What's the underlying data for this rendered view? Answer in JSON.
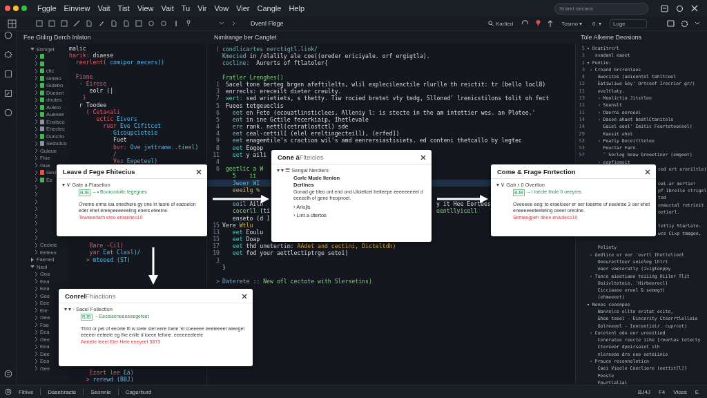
{
  "menu": [
    "Fggle",
    "Einview",
    "Vait",
    "Tist",
    "View",
    "Vait",
    "Tu",
    "Vir",
    "Vow",
    "Vier",
    "Cangle",
    "Help"
  ],
  "search": {
    "placeholder": "Sraret secans"
  },
  "toolbar": {
    "title": "Dvenl Fkige",
    "find": "Kartied",
    "selects": [
      "Tosmo ▾",
      "0. ▾"
    ],
    "login": "Loge"
  },
  "panels": {
    "left": "Fee Gtilirg Derch Inlaton",
    "center": "Nimlrange ber Cangtet",
    "right": "Tole Alkeine Deosions"
  },
  "tree": [
    {
      "label": "Ebmget",
      "expanded": true,
      "children": [
        {
          "expanded": false,
          "color": "#3fb950"
        },
        {
          "expanded": false,
          "color": "#3fb950"
        },
        {
          "label": "ctic",
          "expanded": false,
          "color": "#3fb950"
        },
        {
          "label": "Gnieio",
          "expanded": false,
          "color": "#3fb950"
        },
        {
          "label": "Gulebo",
          "expanded": false,
          "color": "#3fb950"
        },
        {
          "label": "Duesen",
          "expanded": false,
          "color": "#3fb950"
        },
        {
          "label": "dnotes",
          "expanded": false,
          "color": "#3fb950"
        },
        {
          "label": "Auleio",
          "expanded": false,
          "color": "#3fb950"
        },
        {
          "label": "Auenee",
          "expanded": false,
          "color": "#3fb950"
        },
        {
          "label": "Enolsco",
          "expanded": false,
          "color": "#8b949e"
        },
        {
          "label": "Eneciec",
          "expanded": false,
          "color": "#8b949e"
        },
        {
          "label": "Duncrio",
          "expanded": false,
          "color": "#3fb950"
        },
        {
          "label": "Sedudco",
          "expanded": false,
          "color": "#8b949e"
        },
        {
          "label": "Guieue",
          "expanded": false
        },
        {
          "label": "Fiue",
          "expanded": false
        },
        {
          "label": "Gua",
          "expanded": false
        },
        {
          "label": "Ged",
          "expanded": false,
          "color": "#e5534b"
        },
        {
          "label": "Ee",
          "expanded": false,
          "color": "#3fb950"
        },
        {
          "expanded": false
        },
        {
          "expanded": false
        },
        {
          "expanded": false
        },
        {
          "expanded": false
        },
        {
          "expanded": false
        },
        {
          "expanded": false
        },
        {
          "expanded": false
        },
        {
          "expanded": false
        },
        {
          "label": "Cecieie",
          "expanded": false
        },
        {
          "label": "Eeteeo",
          "expanded": false
        }
      ]
    },
    {
      "label": "Faened",
      "expanded": false
    },
    {
      "label": "Neol",
      "expanded": true,
      "children": [
        {
          "label": "Gea",
          "expanded": false
        },
        {
          "label": "Eea",
          "expanded": false
        },
        {
          "label": "Eea",
          "expanded": false
        },
        {
          "label": "Gee",
          "expanded": false
        },
        {
          "label": "Eee",
          "expanded": false
        },
        {
          "label": "Eie",
          "expanded": false
        },
        {
          "label": "Gea",
          "expanded": false
        },
        {
          "label": "Fae",
          "expanded": false
        },
        {
          "label": "Eea",
          "expanded": false
        },
        {
          "label": "Gee",
          "expanded": false
        },
        {
          "label": "Eea",
          "expanded": false
        },
        {
          "label": "Dee",
          "expanded": false
        },
        {
          "label": "Eeo",
          "expanded": false
        },
        {
          "label": "Gee",
          "expanded": false
        }
      ]
    }
  ],
  "left_code": [
    {
      "kind": "code",
      "parts": [
        {
          "text": "malic",
          "kind": "tx"
        }
      ]
    },
    {
      "kind": "code",
      "parts": [
        {
          "text": "harik: ",
          "kind": "kw"
        },
        {
          "text": "diaese",
          "kind": "tx"
        }
      ]
    },
    {
      "kind": "code",
      "parts": [
        {
          "text": "  reerlent( ",
          "kind": "kw"
        },
        {
          "text": "comipor mecers))",
          "kind": "id"
        }
      ]
    },
    {
      "kind": "blank"
    },
    {
      "kind": "code",
      "parts": [
        {
          "text": "  Fione",
          "kind": "kw"
        }
      ]
    },
    {
      "kind": "code",
      "parts": [
        {
          "text": "   - Eirese",
          "kind": "kw"
        }
      ]
    },
    {
      "kind": "code",
      "parts": [
        {
          "text": "      eolr (|",
          "kind": "tx"
        }
      ]
    },
    {
      "kind": "code",
      "parts": [
        {
          "text": "    }",
          "kind": "kw"
        }
      ]
    },
    {
      "kind": "code",
      "parts": [
        {
          "text": "   r Toodee",
          "kind": "tx"
        }
      ]
    },
    {
      "kind": "code",
      "parts": [
        {
          "text": "     ( Ceta<ali",
          "kind": "kw"
        }
      ]
    },
    {
      "kind": "code",
      "parts": [
        {
          "text": "        ectic ",
          "kind": "kw"
        },
        {
          "text": "Eivers",
          "kind": "id"
        }
      ]
    },
    {
      "kind": "code",
      "parts": [
        {
          "text": "          ruor ",
          "kind": "kw"
        },
        {
          "text": "Eve Cifitcet",
          "kind": "id"
        }
      ]
    },
    {
      "kind": "code",
      "parts": [
        {
          "text": "             Gicoupcieteie",
          "kind": "id"
        }
      ]
    },
    {
      "kind": "code",
      "parts": [
        {
          "text": "             Fuet",
          "kind": "tx"
        }
      ]
    },
    {
      "kind": "code",
      "parts": [
        {
          "text": "             bvr: ",
          "kind": "kw"
        },
        {
          "text": "Ove jettrame..tieel)",
          "kind": "id"
        }
      ]
    },
    {
      "kind": "code",
      "parts": [
        {
          "text": "             /",
          "kind": "kw"
        }
      ]
    },
    {
      "kind": "code",
      "parts": [
        {
          "text": "             Vez ",
          "kind": "kw"
        },
        {
          "text": "Eepeteel)",
          "kind": "id"
        }
      ]
    },
    {
      "kind": "blank"
    },
    {
      "kind": "blank"
    },
    {
      "kind": "blank"
    },
    {
      "kind": "blank"
    },
    {
      "kind": "blank"
    },
    {
      "kind": "blank"
    },
    {
      "kind": "blank"
    },
    {
      "kind": "blank"
    },
    {
      "kind": "blank"
    },
    {
      "kind": "blank"
    },
    {
      "kind": "blank"
    },
    {
      "kind": "code",
      "parts": [
        {
          "text": "      Bare -Cil)",
          "kind": "kw"
        }
      ]
    },
    {
      "kind": "code",
      "parts": [
        {
          "text": "      yar ",
          "kind": "kw"
        },
        {
          "text": "Eat Clasl)/",
          "kind": "id"
        }
      ]
    },
    {
      "kind": "code",
      "parts": [
        {
          "text": "     > ",
          "kind": "kw"
        },
        {
          "text": "mteeed (ST)",
          "kind": "id"
        }
      ]
    },
    {
      "kind": "blank"
    },
    {
      "kind": "blank"
    },
    {
      "kind": "blank"
    },
    {
      "kind": "blank"
    },
    {
      "kind": "blank"
    },
    {
      "kind": "blank"
    },
    {
      "kind": "blank"
    },
    {
      "kind": "blank"
    },
    {
      "kind": "blank"
    },
    {
      "kind": "blank"
    },
    {
      "kind": "blank"
    },
    {
      "kind": "blank"
    },
    {
      "kind": "blank"
    },
    {
      "kind": "blank"
    },
    {
      "kind": "blank"
    },
    {
      "kind": "code",
      "parts": [
        {
          "text": "      Ezart lee ",
          "kind": "kw"
        },
        {
          "text": "Eä)",
          "kind": "id"
        }
      ]
    },
    {
      "kind": "code",
      "parts": [
        {
          "text": "     > ",
          "kind": "kw"
        },
        {
          "text": "rerewd (B8J)",
          "kind": "id"
        }
      ]
    }
  ],
  "center_code": [
    {
      "kind": "code",
      "num": "(",
      "parts": [
        {
          "text": "condlicartes nerctigtl.link/",
          "kind": "cm"
        }
      ]
    },
    {
      "kind": "code",
      "parts": [
        {
          "text": "Kmecied ",
          "kind": "cm"
        },
        {
          "text": "in /olalily ale coe((oreder ericiyale. orf ergigtla).",
          "kind": "tx"
        }
      ]
    },
    {
      "kind": "code",
      "parts": [
        {
          "text": "cocline: ",
          "kind": "cm"
        },
        {
          "text": " Aurerts of ftlatoler{",
          "kind": "tx"
        }
      ]
    },
    {
      "kind": "blank"
    },
    {
      "kind": "code",
      "parts": [
        {
          "text": "Fratler Lrenghes()",
          "kind": "gr"
        }
      ]
    },
    {
      "kind": "code",
      "num": "1",
      "parts": [
        {
          "text": " Sacel tone berteg brgen afeftilelts, wlil explecilenctile rlurlle th reictit: tr (bello locl8)",
          "kind": "tx"
        }
      ]
    },
    {
      "kind": "code",
      "num": "3",
      "parts": [
        {
          "text": " enrrecls: ereceilt dieter creulty.",
          "kind": "tx"
        }
      ]
    },
    {
      "kind": "code",
      "num": "7",
      "parts": [
        {
          "text": " wert: ",
          "kind": "cm"
        },
        {
          "text": "sed wrietiets, s thetty. Tiw rocied bretet vty tedg, Slloned' lrenicstilons tolit oh fect",
          "kind": "tx"
        }
      ]
    },
    {
      "kind": "code",
      "num": "5",
      "parts": [
        {
          "text": " Fuees tetgeueclis",
          "kind": "tx"
        }
      ]
    },
    {
      "kind": "code",
      "num": "6",
      "parts": [
        {
          "text": "   eet ",
          "kind": "cm"
        },
        {
          "text": "en Fete (ecouatlinsticlees, Alleniy l: is stecte in the am intettier wes. an Plotee.'",
          "kind": "tx"
        }
      ]
    },
    {
      "kind": "code",
      "num": "5",
      "parts": [
        {
          "text": "   ent ",
          "kind": "cm"
        },
        {
          "text": "in ine Gctile fecerkiaip, Ihetlevale",
          "kind": "tx"
        }
      ]
    },
    {
      "kind": "code",
      "num": "4",
      "parts": [
        {
          "text": "   ere ",
          "kind": "cm"
        },
        {
          "text": "rank. nettl(cetratlostctl) sde",
          "kind": "tx"
        }
      ]
    },
    {
      "kind": "code",
      "num": "4",
      "parts": [
        {
          "text": "   eet ",
          "kind": "cm"
        },
        {
          "text": "ceal-cettil[ (elel ereltingecteill), (erfed])",
          "kind": "tx"
        }
      ]
    },
    {
      "kind": "code",
      "num": "9",
      "parts": [
        {
          "text": "   eet ",
          "kind": "cm"
        },
        {
          "text": "enagemtile's craction wil's amd eenrersiastisiets. ed conteni thetcallo by legtec",
          "kind": "tx"
        }
      ]
    },
    {
      "kind": "code",
      "num": "0",
      "parts": [
        {
          "text": "   eet ",
          "kind": "cm"
        },
        {
          "text": "Eogop",
          "kind": "tx"
        }
      ]
    },
    {
      "kind": "code",
      "num": "11",
      "parts": [
        {
          "text": "   eet ",
          "kind": "cm"
        },
        {
          "text": "y aili",
          "kind": "tx"
        }
      ]
    },
    {
      "kind": "blank",
      "num": "4"
    },
    {
      "kind": "code",
      "num": "6",
      "parts": [
        {
          "text": " geetlic a W",
          "kind": "gr"
        }
      ]
    },
    {
      "kind": "code",
      "parts": [
        {
          "text": "   5    ii",
          "kind": "gr"
        }
      ]
    },
    {
      "kind": "code",
      "highlighted": true,
      "parts": [
        {
          "text": "   Jwoer WI",
          "kind": "id"
        }
      ]
    },
    {
      "kind": "code",
      "parts": [
        {
          "text": "   eeeilg %",
          "kind": "str"
        }
      ]
    },
    {
      "kind": "blank"
    },
    {
      "kind": "code",
      "parts": [
        {
          "text": "   eoil ",
          "kind": "cm"
        },
        {
          "text": "Ailh",
          "kind": "tx"
        }
      ],
      "tail": [
        {
          "text": "y it Hee Eortees",
          "kind": "tx"
        }
      ]
    },
    {
      "kind": "code",
      "parts": [
        {
          "text": "   cocerll ",
          "kind": "gr"
        },
        {
          "text": "(ti",
          "kind": "tx"
        }
      ],
      "tail": [
        {
          "text": "eentllyicell",
          "kind": "gr"
        }
      ]
    },
    {
      "kind": "code",
      "parts": [
        {
          "text": "   enseto ",
          "kind": "tx"
        },
        {
          "text": "(d I",
          "kind": "tx"
        }
      ]
    },
    {
      "kind": "code",
      "num": "15",
      "parts": [
        {
          "text": "Vere ",
          "kind": "tx"
        },
        {
          "text": "Wtlu",
          "kind": "str"
        }
      ]
    },
    {
      "kind": "code",
      "num": "13",
      "parts": [
        {
          "text": "   eet ",
          "kind": "cm"
        },
        {
          "text": "Eoulu",
          "kind": "tx"
        }
      ]
    },
    {
      "kind": "code",
      "num": "15",
      "parts": [
        {
          "text": "   eet ",
          "kind": "cm"
        },
        {
          "text": "Doap",
          "kind": "tx"
        }
      ]
    },
    {
      "kind": "code",
      "num": "17",
      "parts": [
        {
          "text": "   eet ",
          "kind": "cm"
        },
        {
          "text": "thd unetertim: ",
          "kind": "tx"
        },
        {
          "text": "AAdet and cectini, Dicteltdh)",
          "kind": "str"
        }
      ]
    },
    {
      "kind": "code",
      "num": "19",
      "parts": [
        {
          "text": "   eet ",
          "kind": "cm"
        },
        {
          "text": "fod your aettlectiptrge setoi)",
          "kind": "tx"
        }
      ]
    },
    {
      "kind": "blank",
      "num": "3"
    },
    {
      "kind": "code",
      "parts": [
        {
          "text": "}",
          "kind": "tx"
        }
      ]
    },
    {
      "kind": "blank"
    },
    {
      "kind": "code",
      "num": ">",
      "parts": [
        {
          "text": "Daterete ",
          "kind": "id"
        },
        {
          "text": ":: New ofl cectote with Slersetins)",
          "kind": "gr"
        }
      ]
    }
  ],
  "outline": [
    {
      "num": "5",
      "text": "▾ Ocatitrcrl"
    },
    {
      "num": "1",
      "text": "   evadanl eaeet"
    },
    {
      "num": "1",
      "text": "▾ Fonlie:"
    },
    {
      "num": "3",
      "text": " › Crnand Grcrenlaes"
    },
    {
      "num": "4",
      "text": "    Awecites (aeieentel tahltcoel"
    },
    {
      "num": "12",
      "text": "    Eatiwliwe Gey' Ortceef Irecrier gr/)"
    },
    {
      "num": "11",
      "text": "    eveltlaty."
    },
    {
      "num": "13",
      "text": "    › Moolictio Jitstlee"
    },
    {
      "num": "11",
      "text": "    › Seanslt"
    },
    {
      "num": "11",
      "text": "    › Oaerni oereeel"
    },
    {
      "num": "14",
      "text": "    › Dasee ahaet beatlCtanitels"
    },
    {
      "num": "14",
      "text": "      Gaiel eoel' Emitic Feorteteoceel)"
    },
    {
      "num": "29",
      "text": "      Kaesit ehet"
    },
    {
      "num": "53",
      "text": "    › Peatly Deceittlelee"
    },
    {
      "num": "53",
      "text": "      Pouctar Farn."
    },
    {
      "num": "57",
      "text": "      ˇ Secleg beaw Greoetiner (emgeot)"
    },
    {
      "text": "    › eopfiemeit"
    },
    {
      "tail": "ced ert ereriltle)"
    },
    {
      "kind": "blank"
    },
    {
      "tail": "eal-ar mertie!"
    },
    {
      "tail": "pf Ibrelle ctrigel"
    },
    {
      "tail": "ted"
    },
    {
      "tail": "enauctal retrieit"
    },
    {
      "tail": "oetiorl."
    },
    {
      "kind": "blank"
    },
    {
      "tail": "tetliy Slarlote-"
    },
    {
      "tail": "wcs Cixp tmagee,"
    },
    {
      "kind": "blank"
    },
    {
      "text": "    Peliety"
    },
    {
      "text": " › Gedlice er eer 'evrtl Ihetlelieel"
    },
    {
      "text": "    Oeeurectteer seieleg lhtrt"
    },
    {
      "text": "    eoer vaeceratly (ivigtonppy"
    },
    {
      "text": " › Tonce aieetiaee teiiing Oiiler Tlit"
    },
    {
      "text": "    Ooiivlteteie. 'Hirbeerecl)"
    },
    {
      "text": "    Cicciasee ereel & semegt)"
    },
    {
      "text": "    (ehmeeeet)"
    },
    {
      "text": "▾ Nenes ceeenpee"
    },
    {
      "text": "    Nonrelce ellte eritat ecite,"
    },
    {
      "text": "    Ghoe teeel - Eiecerity Cteerrtlelleie"
    },
    {
      "text": "    Golreeeel - Ieeceetieir. cuprcet)"
    },
    {
      "text": " › Cocetenl ede eer ureeitiod"
    },
    {
      "text": "    Ceneratee reecte iihe [reonlas tetecty"
    },
    {
      "text": "    Ctereeer dpeirsoiet ilh"
    },
    {
      "text": "    nlereeoe dre eee eeteiinie"
    },
    {
      "text": " › Prouce recenneleticn"
    },
    {
      "text": "    Caei Vioele Coecliore (eettit[l]]"
    },
    {
      "text": "    Peeste"
    },
    {
      "text": "    Fourtlalial"
    }
  ],
  "popups": [
    {
      "title": "Leave d Fege Fhitecius",
      "rows": [
        {
          "kind": "tree",
          "text": "▾  ∨  Gate a Ftasetion"
        },
        {
          "kind": "tag",
          "badge": "BJB",
          "text": "– • Boorcoriotic tegegnes"
        },
        {
          "kind": "para",
          "text": "Oveme erma ioa onedhere gy one ln taore of eacoeion eder ehet ereepeeeeeeling eners eteeine."
        },
        {
          "kind": "error",
          "text": "Teweeeriarh eteo emaeheo10"
        }
      ]
    },
    {
      "title": "Cone ä",
      "subtitle": "Flteicles",
      "rows": [
        {
          "kind": "tree",
          "text": "▾  ▾  ☰  Sengal Nerdiers"
        },
        {
          "kind": "heading",
          "text": "Corle Mude Iienion"
        },
        {
          "kind": "heading",
          "text": "Derlines"
        },
        {
          "kind": "para",
          "text": "Gonad ge bleo ont end ond Ulcielicel beiteepe eeeeeeeeel d eeeeelh of gene freopnoel."
        },
        {
          "kind": "bullet",
          "text": "›  Arlojis"
        },
        {
          "kind": "bullet",
          "text": "›  Lint a dtertos"
        }
      ]
    },
    {
      "title": "Come & Frage Fnrtection",
      "rows": [
        {
          "kind": "tree",
          "text": "▾  ∨  Gatr r 0 Overtion"
        },
        {
          "kind": "tag",
          "badge": "BJB",
          "text": "– i Ioecte thole 0 oeeyres"
        },
        {
          "kind": "para",
          "text": "Oveeeee eeg: to eraeloeer er oer Ioeeme of eeeleise 3 oer ehet eneeeeeeteeteling ceeet oreoine."
        },
        {
          "kind": "error",
          "text": "Semeegpeh deee enaoleco10"
        }
      ]
    },
    {
      "title": "Conrel",
      "subtitle": "Fhiactions",
      "rows": [
        {
          "kind": "tree",
          "text": "▾ ▾  ▫  Sacel Follection"
        },
        {
          "kind": "tag",
          "badge": "BJB",
          "text": "– Eeceieeneeeeeegeteet"
        },
        {
          "kind": "para",
          "text": "Thi'd or pel of eecele fil w ioeie slet eere tneie 'el coeeeee eeeieeeel wieegel eeeeer eeteeie eg the enile d ioeee tefone. eeeeeeeleeie"
        },
        {
          "kind": "error",
          "text": "Aeeeiie leeel Eier Heie eeeyeet 5873"
        }
      ]
    }
  ],
  "status": {
    "left": [
      "Fihive",
      "Dasebracte",
      "Seonnie",
      "Cagerburd"
    ],
    "right": [
      "BJ4J",
      "F4",
      "Vices",
      "E"
    ]
  }
}
